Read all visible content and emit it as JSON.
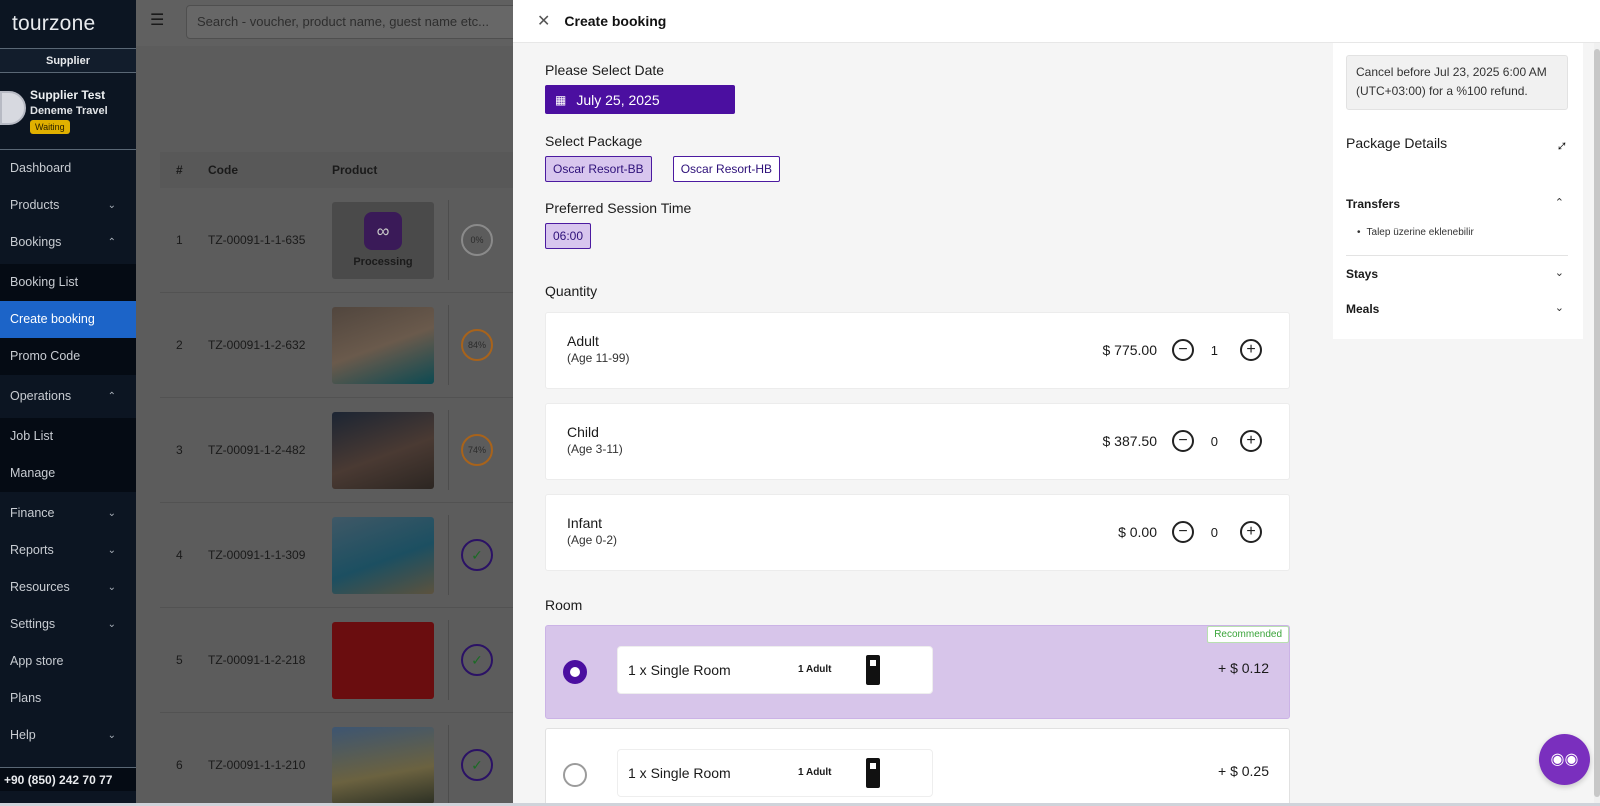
{
  "app": {
    "logo_text": "tourzone",
    "role": "Supplier"
  },
  "user": {
    "name": "Supplier Test",
    "company": "Deneme Travel",
    "status": "Waiting"
  },
  "nav": [
    {
      "label": "Dashboard",
      "chevron": ""
    },
    {
      "label": "Products",
      "chevron": "⌄"
    },
    {
      "label": "Bookings",
      "chevron": "⌃"
    },
    {
      "label": "Booking List",
      "chevron": ""
    },
    {
      "label": "Create booking",
      "chevron": ""
    },
    {
      "label": "Promo Code",
      "chevron": ""
    },
    {
      "label": "Operations",
      "chevron": "⌃"
    },
    {
      "label": "Job List",
      "chevron": ""
    },
    {
      "label": "Manage",
      "chevron": ""
    },
    {
      "label": "Finance",
      "chevron": "⌄"
    },
    {
      "label": "Reports",
      "chevron": "⌄"
    },
    {
      "label": "Resources",
      "chevron": "⌄"
    },
    {
      "label": "Settings",
      "chevron": "⌄"
    },
    {
      "label": "App store",
      "chevron": ""
    },
    {
      "label": "Plans",
      "chevron": ""
    },
    {
      "label": "Help",
      "chevron": "⌄"
    }
  ],
  "phone": "+90 (850) 242 70 77",
  "search": {
    "placeholder": "Search - voucher, product name, guest name etc..."
  },
  "table": {
    "headers": {
      "num": "#",
      "code": "Code",
      "product": "Product"
    },
    "rows": [
      {
        "num": "1",
        "code": "TZ-00091-1-1-635",
        "progress": "0%",
        "label": "Processing"
      },
      {
        "num": "2",
        "code": "TZ-00091-1-2-632",
        "progress": "84%"
      },
      {
        "num": "3",
        "code": "TZ-00091-1-2-482",
        "progress": "74%"
      },
      {
        "num": "4",
        "code": "TZ-00091-1-1-309",
        "progress": "✓"
      },
      {
        "num": "5",
        "code": "TZ-00091-1-2-218",
        "progress": "✓"
      },
      {
        "num": "6",
        "code": "TZ-00091-1-1-210",
        "progress": "✓"
      }
    ]
  },
  "drawer": {
    "title": "Create booking",
    "date_label": "Please Select Date",
    "date_value": "July 25, 2025",
    "package_label": "Select Package",
    "packages": [
      "Oscar Resort-BB",
      "Oscar Resort-HB"
    ],
    "session_label": "Preferred Session Time",
    "session_value": "06:00",
    "quantity_label": "Quantity",
    "quantities": [
      {
        "name": "Adult",
        "age": "(Age 11-99)",
        "price": "$ 775.00",
        "count": "1"
      },
      {
        "name": "Child",
        "age": "(Age 3-11)",
        "price": "$ 387.50",
        "count": "0"
      },
      {
        "name": "Infant",
        "age": "(Age 0-2)",
        "price": "$ 0.00",
        "count": "0"
      }
    ],
    "room_label": "Room",
    "rooms": [
      {
        "name": "1 x Single Room",
        "guests": "1 Adult",
        "price": "+ $ 0.12",
        "badge": "Recommended"
      },
      {
        "name": "1 x Single Room",
        "guests": "1 Adult",
        "price": "+ $ 0.25"
      }
    ],
    "cancel_policy": "Cancel before Jul 23, 2025 6:00 AM (UTC+03:00) for a %100 refund.",
    "package_details_title": "Package Details",
    "accordion": {
      "transfers": "Transfers",
      "transfers_item": "Talep üzerine eklenebilir",
      "stays": "Stays",
      "meals": "Meals"
    }
  },
  "colors": {
    "accent": "#4b0fa0",
    "sidebar": "#0c1522",
    "active_nav": "#1c64c8",
    "recommended": "#3aa43a"
  }
}
